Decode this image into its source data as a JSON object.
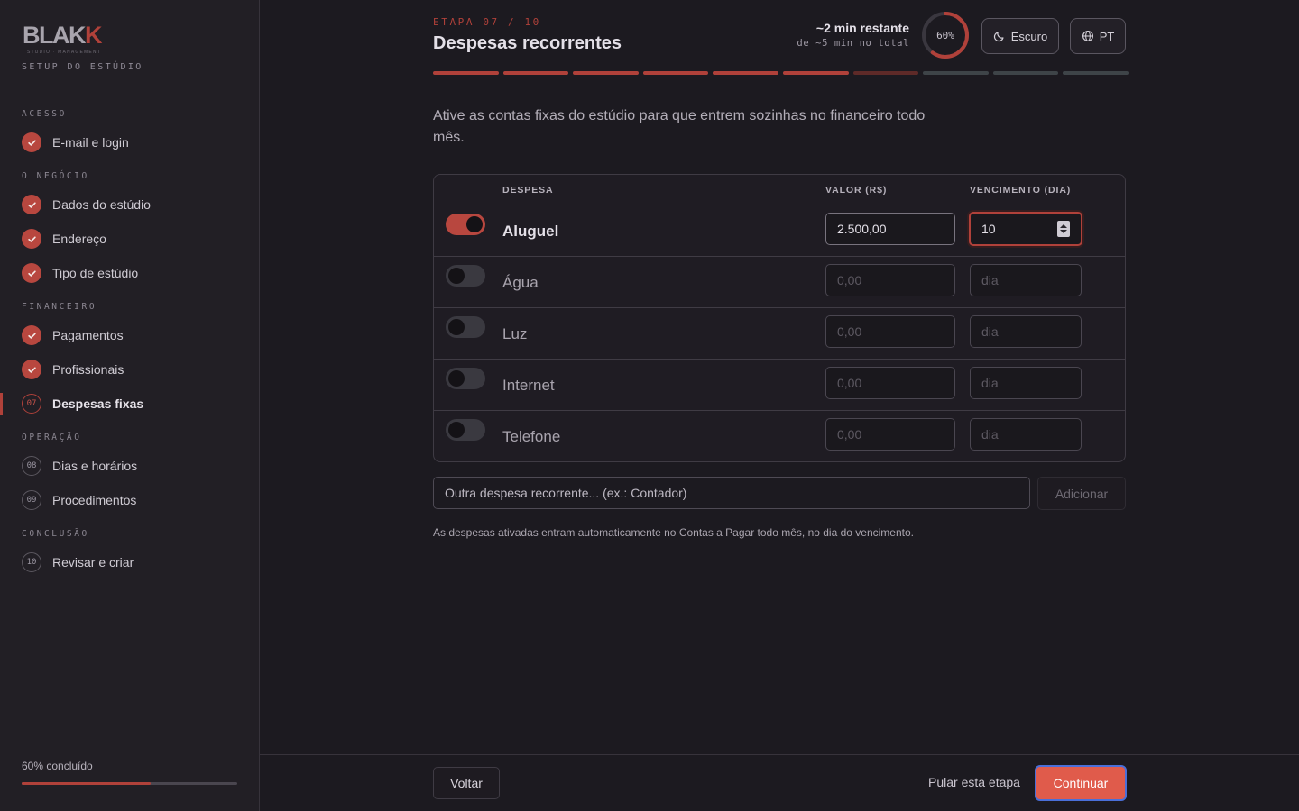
{
  "brand": {
    "logo_text_main": "BLAK",
    "logo_text_accent": "K",
    "logo_tagline": "STUDIO · MANAGEMENT",
    "setup_label": "SETUP DO ESTÚDIO"
  },
  "sidebar": {
    "sections": [
      {
        "label": "ACESSO"
      },
      {
        "label": "O NEGÓCIO"
      },
      {
        "label": "FINANCEIRO"
      },
      {
        "label": "OPERAÇÃO"
      },
      {
        "label": "CONCLUSÃO"
      }
    ],
    "items": [
      {
        "label": "E-mail e login",
        "status": "done",
        "number": ""
      },
      {
        "label": "Dados do estúdio",
        "status": "done",
        "number": ""
      },
      {
        "label": "Endereço",
        "status": "done",
        "number": ""
      },
      {
        "label": "Tipo de estúdio",
        "status": "done",
        "number": ""
      },
      {
        "label": "Pagamentos",
        "status": "done",
        "number": ""
      },
      {
        "label": "Profissionais",
        "status": "done",
        "number": ""
      },
      {
        "label": "Despesas fixas",
        "status": "active",
        "number": "07"
      },
      {
        "label": "Dias e horários",
        "status": "pending",
        "number": "08"
      },
      {
        "label": "Procedimentos",
        "status": "pending",
        "number": "09"
      },
      {
        "label": "Revisar e criar",
        "status": "pending",
        "number": "10"
      }
    ],
    "progress_label": "60% concluído",
    "progress_value": 0.6
  },
  "header": {
    "step_label": "ETAPA 07 / 10",
    "title": "Despesas recorrentes",
    "time_remaining": "~2 min restante",
    "time_total": "de ~5 min no total",
    "progress_percent_label": "60%",
    "progress_value": 0.6,
    "steps_total": 10,
    "steps_done": 6,
    "current_step": 7,
    "theme_button": "Escuro",
    "language_button": "PT"
  },
  "main": {
    "intro": "Ative as contas fixas do estúdio para que entrem sozinhas no financeiro todo mês.",
    "table": {
      "columns": [
        "DESPESA",
        "VALOR (R$)",
        "VENCIMENTO (DIA)"
      ],
      "rows": [
        {
          "name": "Aluguel",
          "enabled": true,
          "value": "2.500,00",
          "day": "10",
          "value_placeholder": "0,00",
          "day_placeholder": "dia"
        },
        {
          "name": "Água",
          "enabled": false,
          "value": "",
          "day": "",
          "value_placeholder": "0,00",
          "day_placeholder": "dia"
        },
        {
          "name": "Luz",
          "enabled": false,
          "value": "",
          "day": "",
          "value_placeholder": "0,00",
          "day_placeholder": "dia"
        },
        {
          "name": "Internet",
          "enabled": false,
          "value": "",
          "day": "",
          "value_placeholder": "0,00",
          "day_placeholder": "dia"
        },
        {
          "name": "Telefone",
          "enabled": false,
          "value": "",
          "day": "",
          "value_placeholder": "0,00",
          "day_placeholder": "dia"
        }
      ]
    },
    "other_expense_placeholder": "Outra despesa recorrente... (ex.: Contador)",
    "add_button": "Adicionar",
    "note": "As despesas ativadas entram automaticamente no Contas a Pagar todo mês, no dia do vencimento."
  },
  "footer": {
    "back_button": "Voltar",
    "skip_link": "Pular esta etapa",
    "continue_button": "Continuar"
  },
  "colors": {
    "accent": "#b0413a",
    "primary_button": "#e05b4b",
    "background": "#1c1a20",
    "sidebar": "#221f25"
  },
  "icons": [
    "check-icon",
    "moon-icon",
    "globe-icon",
    "spinner-icon"
  ]
}
